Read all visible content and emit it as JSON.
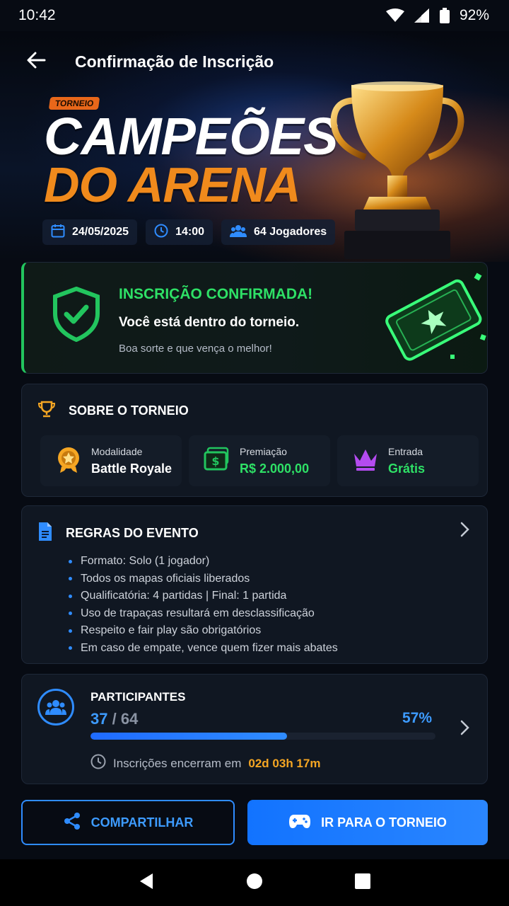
{
  "status": {
    "time": "10:42",
    "battery": "92%"
  },
  "appbar": {
    "title": "Confirmação de Inscrição"
  },
  "hero": {
    "tag": "TORNEIO",
    "title_line1": "CAMPEÕES",
    "title_line2": "DO ARENA",
    "date": "24/05/2025",
    "time": "14:00",
    "players": "64 Jogadores"
  },
  "confirmation": {
    "title": "INSCRIÇÃO CONFIRMADA!",
    "subtitle": "Você está dentro do torneio.",
    "note": "Boa sorte e que vença o melhor!"
  },
  "about": {
    "heading": "SOBRE O TORNEIO",
    "items": [
      {
        "label": "Modalidade",
        "value": "Battle Royale",
        "icon": "medal-icon",
        "color": "#ffffff"
      },
      {
        "label": "Premiação",
        "value": "R$ 2.000,00",
        "icon": "cash-icon",
        "color": "#2ee066"
      },
      {
        "label": "Entrada",
        "value": "Grátis",
        "icon": "crown-icon",
        "color": "#2ee066"
      }
    ]
  },
  "rules": {
    "heading": "REGRAS DO EVENTO",
    "items": [
      "Formato: Solo (1 jogador)",
      "Todos os mapas oficiais liberados",
      "Qualificatória: 4 partidas | Final: 1 partida",
      "Uso de trapaças resultará em desclassificação",
      "Respeito e fair play são obrigatórios",
      "Em caso de empate, vence quem fizer mais abates"
    ]
  },
  "participants": {
    "heading": "PARTICIPANTES",
    "current": "37",
    "separator": "/",
    "total": "64",
    "percent_label": "57%",
    "progress_fraction": 0.57,
    "closing_text": "Inscrições encerram em",
    "closing_time": "02d 03h 17m"
  },
  "actions": {
    "share_label": "COMPARTILHAR",
    "go_label": "IR PARA O TORNEIO"
  },
  "colors": {
    "accent": "#2f8cff",
    "success": "#2ee066",
    "orange": "#f08a1c",
    "background": "#070b13"
  }
}
